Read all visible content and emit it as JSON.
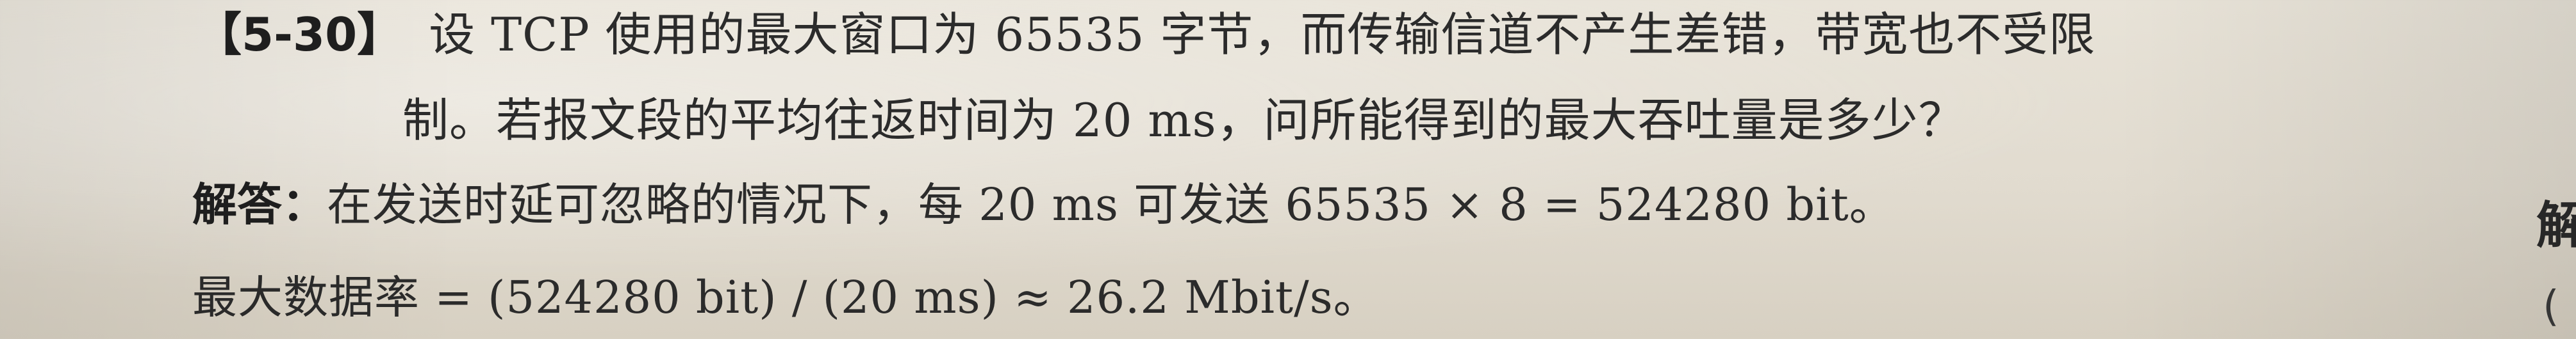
{
  "question": {
    "number": "【5-30】",
    "line1": "设 TCP 使用的最大窗口为 65535 字节，而传输信道不产生差错，带宽也不受限",
    "line2": "制。若报文段的平均往返时间为 20 ms，问所能得到的最大吞吐量是多少？"
  },
  "answer": {
    "label": "解答：",
    "line1": "在发送时延可忽略的情况下，每 20 ms 可发送 65535 × 8 = 524280 bit。",
    "line2": "最大数据率 = (524280 bit) / (20 ms)  ≈  26.2 Mbit/s。"
  },
  "margin": {
    "top_char": "解",
    "bottom_char": "("
  }
}
